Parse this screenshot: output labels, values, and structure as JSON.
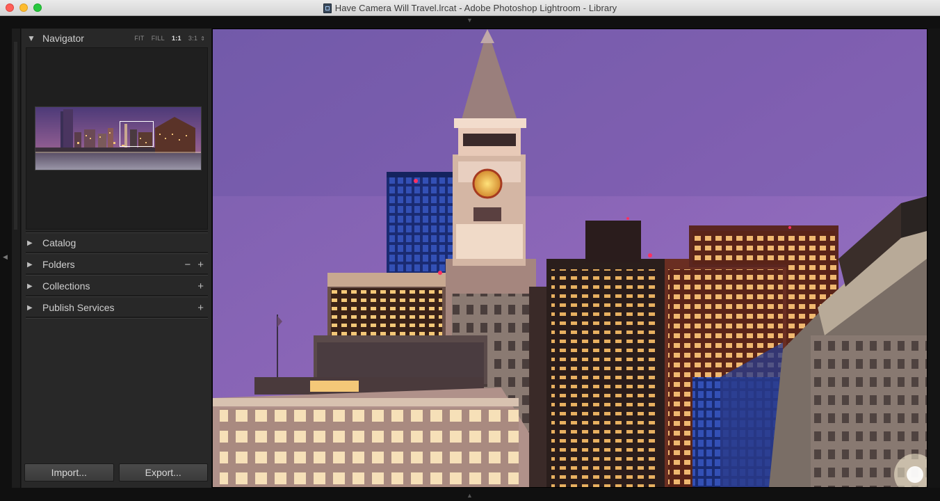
{
  "window": {
    "title": "Have Camera Will Travel.lrcat - Adobe Photoshop Lightroom - Library"
  },
  "navigator": {
    "label": "Navigator",
    "zoom_options": [
      "FIT",
      "FILL",
      "1:1",
      "3:1"
    ],
    "selected_zoom": "1:1"
  },
  "panels": [
    {
      "label": "Catalog",
      "actions": []
    },
    {
      "label": "Folders",
      "actions": [
        "−",
        "+"
      ]
    },
    {
      "label": "Collections",
      "actions": [
        "+"
      ]
    },
    {
      "label": "Publish Services",
      "actions": [
        "+"
      ]
    }
  ],
  "buttons": {
    "import_label": "Import...",
    "export_label": "Export..."
  },
  "icons": {
    "expanded": "triangle-down-icon",
    "collapsed": "triangle-right-icon",
    "add": "plus-icon",
    "remove": "minus-icon"
  }
}
